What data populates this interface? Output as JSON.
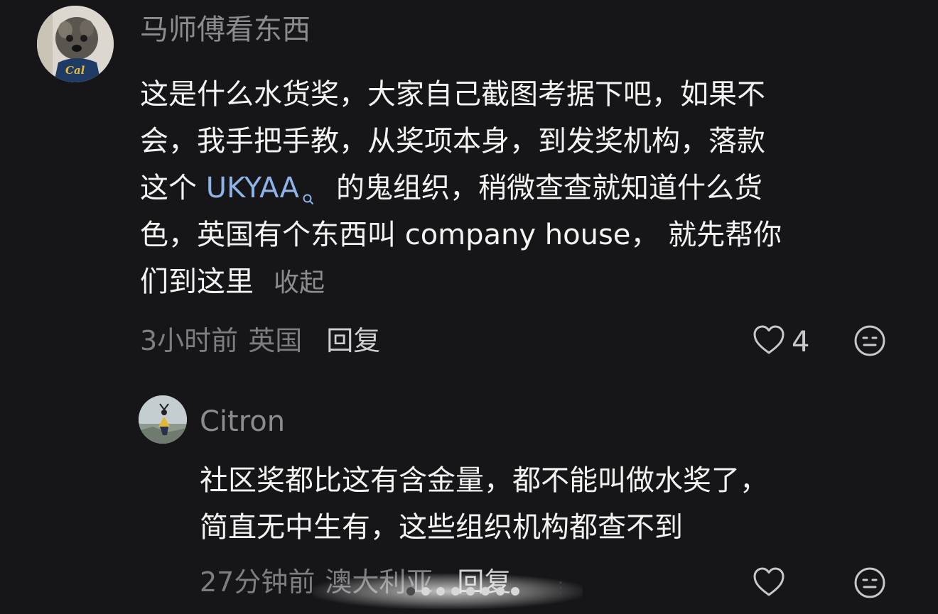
{
  "comment": {
    "username": "马师傅看东西",
    "avatar_label": "Cal",
    "text_lines": [
      "这是什么水货奖，大家自己截图考据下吧，如果不",
      "会，我手把手教，从奖项本身，到发奖机构，落款"
    ],
    "line3_prefix": "这个 ",
    "keyword": "UKYAA",
    "line3_suffix": "的鬼组织，稍微查查就知道什么货",
    "line4": "色，英国有个东西叫 company house， 就先帮你",
    "line5": "们到这里",
    "collapse_label": "收起",
    "time": "3小时前",
    "location": "英国",
    "reply_label": "回复",
    "like_count": "4"
  },
  "reply": {
    "username": "Citron",
    "text_lines": [
      "社区奖都比这有含金量，都不能叫做水奖了，",
      "简直无中生有，这些组织机构都查不到"
    ],
    "time": "27分钟前",
    "location": "澳大利亚",
    "reply_label": "回复"
  },
  "icons": {
    "like": "heart-outline-icon",
    "dislike": "neutral-face-icon",
    "search": "search-icon",
    "more": "more-dots-icon"
  },
  "colors": {
    "background": "#161618",
    "text": "#f3f3f3",
    "muted": "#8c8c90",
    "link": "#8db3e8"
  }
}
